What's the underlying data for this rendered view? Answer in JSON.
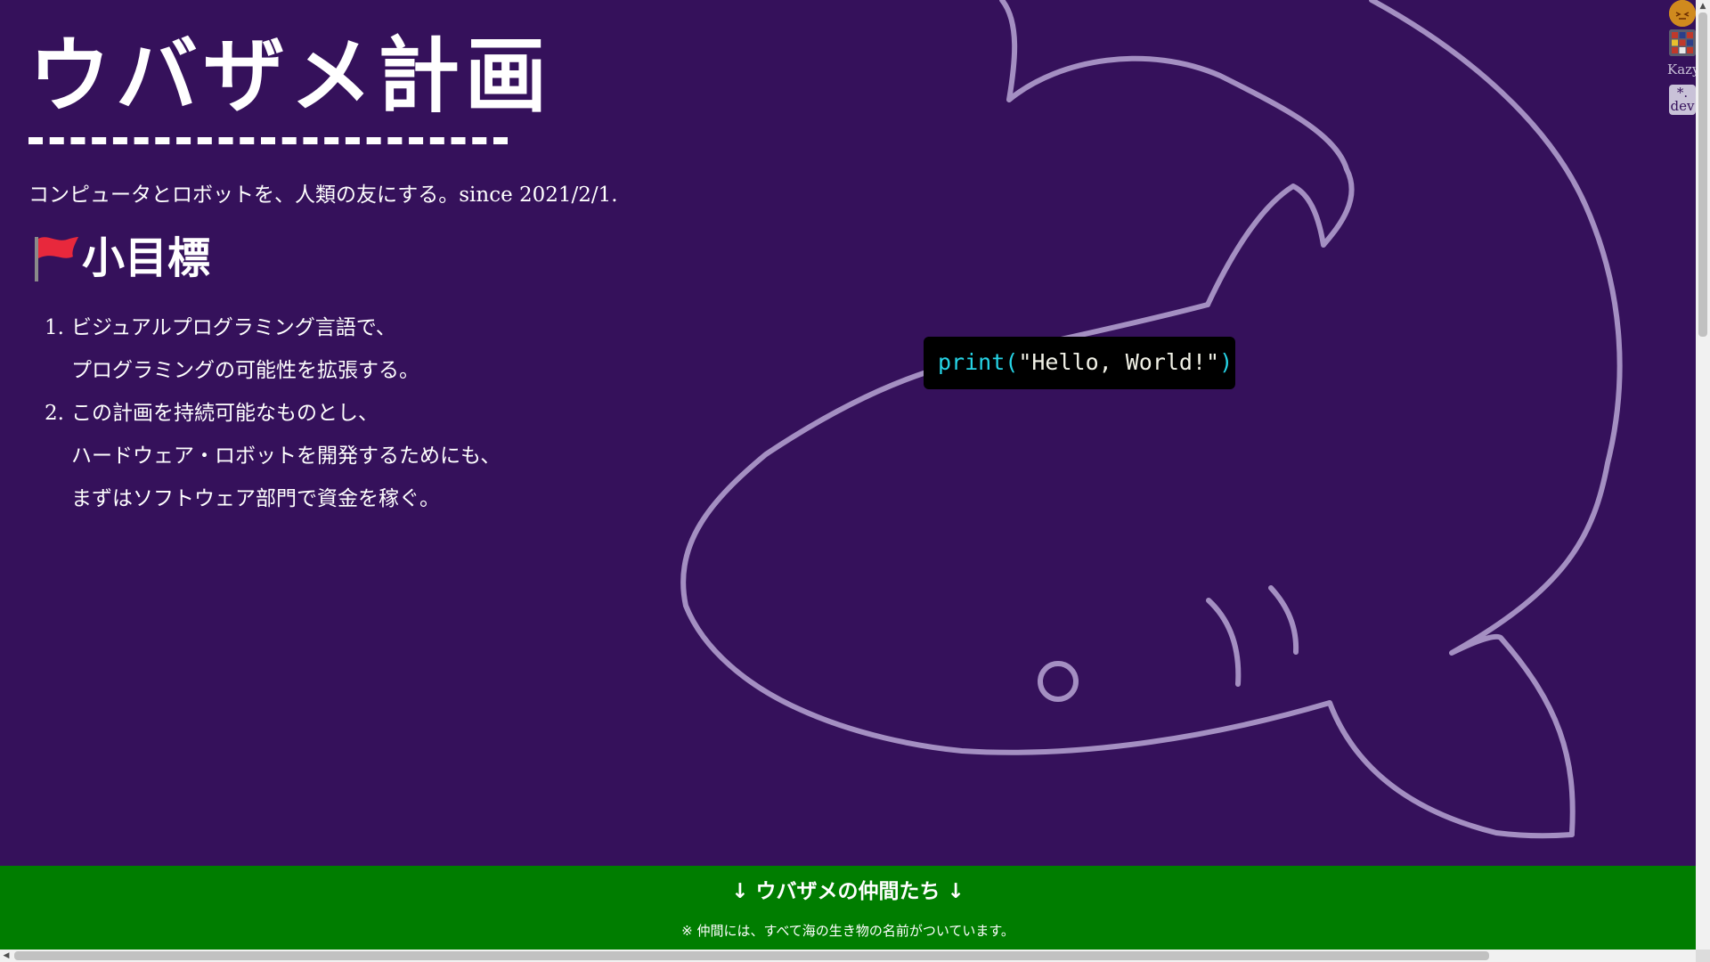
{
  "page": {
    "title": "ウバザメ計画",
    "tagline": "コンピュータとロボットを、人類の友にする。since 2021/2/1."
  },
  "goals": {
    "heading": "小目標",
    "heading_icon": "red-flag-icon",
    "items": [
      {
        "number": "1.",
        "lines": [
          "ビジュアルプログラミング言語で、",
          "プログラミングの可能性を拡張する。"
        ]
      },
      {
        "number": "2.",
        "lines": [
          "この計画を持続可能なものとし、",
          "ハードウェア・ロボットを開発するためにも、",
          "まずはソフトウェア部門で資金を稼ぐ。"
        ]
      }
    ]
  },
  "code_sample": {
    "fn": "print(",
    "str": "\"Hello, World!\"",
    "close": ")"
  },
  "friends": {
    "title": "↓ ウバザメの仲間たち ↓",
    "note": "※ 仲間には、すべて海の生き物の名前がついています。"
  },
  "side_widgets": {
    "avatar_icon": "orange-avatar-icon",
    "cube_icon": "rubiks-cube-icon",
    "kazy_label": "Kazy",
    "dev_label_top": "*.",
    "dev_label_bottom": "dev"
  },
  "colors": {
    "background": "#35115b",
    "shark_outline": "#a48fc2",
    "friends_bar": "#007d00",
    "code_keyword": "#26d4e6"
  }
}
